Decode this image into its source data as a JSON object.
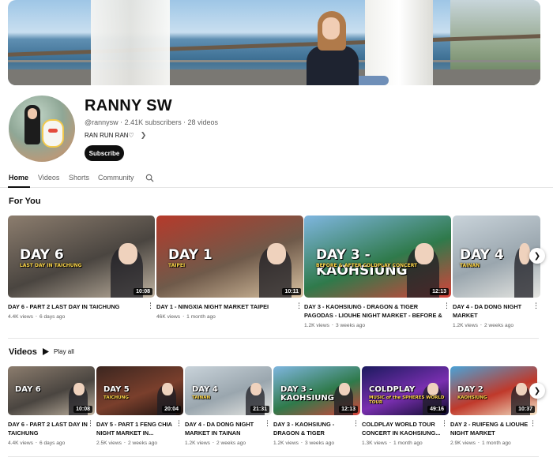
{
  "channel": {
    "name": "RANNY SW",
    "handle": "@rannysw",
    "subscribers": "2.41K subscribers",
    "videos_count": "28 videos",
    "meta_sep": "‧",
    "description": "RAN RUN RAN♡",
    "subscribe_label": "Subscribe"
  },
  "tabs": [
    "Home",
    "Videos",
    "Shorts",
    "Community"
  ],
  "sections": {
    "for_you": "For You",
    "videos": "Videos",
    "play_all": "Play all"
  },
  "for_you": [
    {
      "title": "DAY 6 - PART 2 LAST DAY IN TAICHUNG",
      "views": "4.4K views",
      "age": "6 days ago",
      "duration": "10:08",
      "overlay": "DAY 6",
      "sub_overlay": "LAST DAY IN TAICHUNG",
      "colors": [
        "#8c7d6e",
        "#4a4540",
        "#bfb2a0"
      ]
    },
    {
      "title": "DAY 1 - NINGXIA NIGHT MARKET TAIPEI",
      "views": "46K views",
      "age": "1 month ago",
      "duration": "10:11",
      "overlay": "DAY 1",
      "sub_overlay": "TAIPEI",
      "colors": [
        "#b53a2b",
        "#6f5a4a",
        "#d9c2a1"
      ]
    },
    {
      "title": "DAY 3 - KAOHSIUNG - DRAGON & TIGER PAGODAS - LIOUHE NIGHT MARKET - BEFORE & AFTER...",
      "views": "1.2K views",
      "age": "3 weeks ago",
      "duration": "12:13",
      "overlay": "DAY 3 - KAOHSIUNG",
      "sub_overlay": "BEFORE & AFTER COLDPLAY CONCERT",
      "colors": [
        "#7fb6e0",
        "#2f7a4b",
        "#d8413a"
      ]
    },
    {
      "title": "DAY 4 - DA DONG NIGHT MARKET",
      "views": "1.2K views",
      "age": "2 weeks ago",
      "duration": "",
      "overlay": "DAY 4",
      "sub_overlay": "TAINAN",
      "colors": [
        "#c9d3da",
        "#9aa6ae",
        "#e6e6e2"
      ]
    }
  ],
  "videos": [
    {
      "title": "DAY 6 - PART 2 LAST DAY IN TAICHUNG",
      "views": "4.4K views",
      "age": "6 days ago",
      "duration": "10:08",
      "overlay": "DAY 6",
      "sub_overlay": "",
      "colors": [
        "#8c7d6e",
        "#4a4540",
        "#bfb2a0"
      ]
    },
    {
      "title": "DAY 5 - PART 1 FENG CHIA NIGHT MARKET IN...",
      "views": "2.5K views",
      "age": "2 weeks ago",
      "duration": "20:04",
      "overlay": "DAY 5",
      "sub_overlay": "TAICHUNG",
      "colors": [
        "#3b2620",
        "#7a3f2c",
        "#1a1210"
      ]
    },
    {
      "title": "DAY 4 - DA DONG NIGHT MARKET IN TAINAN",
      "views": "1.2K views",
      "age": "2 weeks ago",
      "duration": "21:31",
      "overlay": "DAY 4",
      "sub_overlay": "TAINAN",
      "colors": [
        "#c9d3da",
        "#9aa6ae",
        "#e6e6e2"
      ]
    },
    {
      "title": "DAY 3 - KAOHSIUNG - DRAGON & TIGER PAGODA...",
      "views": "1.2K views",
      "age": "3 weeks ago",
      "duration": "12:13",
      "overlay": "DAY 3 - KAOHSIUNG",
      "sub_overlay": "",
      "colors": [
        "#7fb6e0",
        "#2f7a4b",
        "#d8413a"
      ]
    },
    {
      "title": "COLDPLAY WORLD TOUR CONCERT IN KAOHSIUNG...",
      "views": "1.3K views",
      "age": "1 month ago",
      "duration": "49:16",
      "overlay": "COLDPLAY",
      "sub_overlay": "MUSIC of the SPHERES WORLD TOUR",
      "colors": [
        "#1b1a5e",
        "#7a2fb0",
        "#0b0b2a"
      ]
    },
    {
      "title": "DAY 2 - RUIFENG & LIOUHE NIGHT MARKET KAOHSIUNG",
      "views": "2.9K views",
      "age": "1 month ago",
      "duration": "10:37",
      "overlay": "DAY 2",
      "sub_overlay": "KAOHSIUNG",
      "colors": [
        "#4aa3d8",
        "#c0392b",
        "#f2e3c6"
      ]
    }
  ],
  "icons": {
    "search": "search-icon",
    "next": "chevron-right-icon",
    "play": "play-icon",
    "more": "more-vert-icon"
  }
}
